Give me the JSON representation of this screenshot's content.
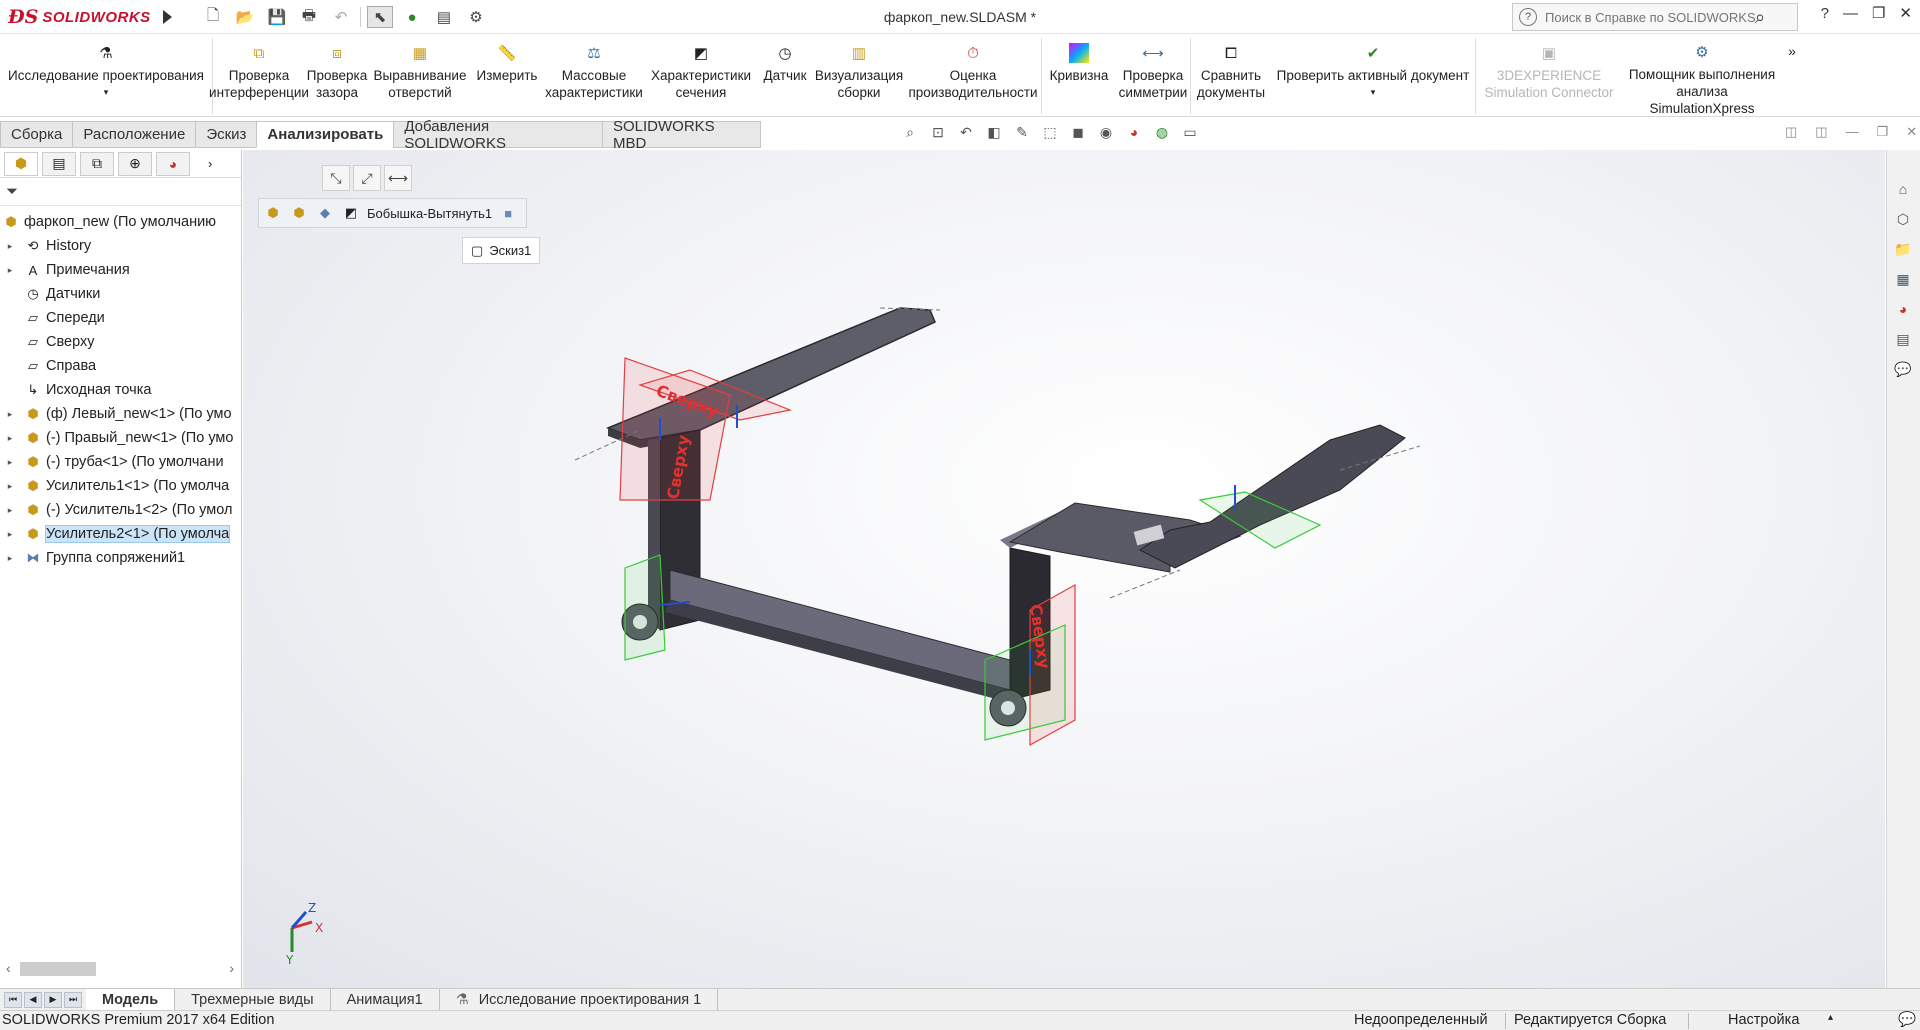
{
  "app": {
    "brand": "SOLIDWORKS",
    "doc_title": "фаркоп_new.SLDASM *"
  },
  "search": {
    "placeholder": "Поиск в Справке по SOLIDWORKS"
  },
  "ribbon": [
    {
      "label": "Исследование проектирования",
      "icon": "design-study-icon"
    },
    {
      "label": "Проверка интерференции",
      "icon": "interference-icon"
    },
    {
      "label": "Проверка зазора",
      "icon": "clearance-icon"
    },
    {
      "label": "Выравнивание отверстий",
      "icon": "hole-align-icon"
    },
    {
      "label": "Измерить",
      "icon": "measure-icon"
    },
    {
      "label": "Массовые характеристики",
      "icon": "mass-props-icon"
    },
    {
      "label": "Характеристики сечения",
      "icon": "section-props-icon"
    },
    {
      "label": "Датчик",
      "icon": "sensor-icon"
    },
    {
      "label": "Визуализация сборки",
      "icon": "assembly-viz-icon"
    },
    {
      "label": "Оценка производительности",
      "icon": "performance-icon"
    },
    {
      "label": "Кривизна",
      "icon": "curvature-icon"
    },
    {
      "label": "Проверка симметрии",
      "icon": "symmetry-icon"
    },
    {
      "label": "Сравнить документы",
      "icon": "compare-icon"
    },
    {
      "label": "Проверить активный документ",
      "icon": "check-doc-icon"
    },
    {
      "label": "3DEXPERIENCE Simulation Connector",
      "icon": "3dx-icon"
    },
    {
      "label": "Помощник выполнения анализа SimulationXpress",
      "icon": "simxpress-icon"
    }
  ],
  "tabs": [
    "Сборка",
    "Расположение",
    "Эскиз",
    "Анализировать",
    "Добавления SOLIDWORKS",
    "SOLIDWORKS MBD"
  ],
  "tree": [
    {
      "label": "фаркоп_new  (По умолчанию",
      "icon": "assembly-icon"
    },
    {
      "label": "History",
      "icon": "history-icon"
    },
    {
      "label": "Примечания",
      "icon": "annotations-icon"
    },
    {
      "label": "Датчики",
      "icon": "sensors-icon"
    },
    {
      "label": "Спереди",
      "icon": "plane-icon"
    },
    {
      "label": "Сверху",
      "icon": "plane-icon"
    },
    {
      "label": "Справа",
      "icon": "plane-icon"
    },
    {
      "label": "Исходная точка",
      "icon": "origin-icon"
    },
    {
      "label": "(ф) Левый_new<1> (По умо",
      "icon": "part-icon"
    },
    {
      "label": "(-) Правый_new<1> (По умо",
      "icon": "part-icon"
    },
    {
      "label": "(-) труба<1> (По умолчани",
      "icon": "part-icon"
    },
    {
      "label": "Усилитель1<1> (По умолча",
      "icon": "part-icon"
    },
    {
      "label": "(-) Усилитель1<2> (По умол",
      "icon": "part-icon"
    },
    {
      "label": "Усилитель2<1> (По умолча",
      "icon": "part-icon"
    },
    {
      "label": "Группа сопряжений1",
      "icon": "mates-icon"
    }
  ],
  "breadcrumb": {
    "feature": "Бобышка-Вытянуть1",
    "sketch": "Эскиз1"
  },
  "viewport": {
    "plane_label": "Сверху"
  },
  "bottom_tabs": [
    "Модель",
    "Трехмерные виды",
    "Анимация1",
    "Исследование проектирования 1"
  ],
  "status": {
    "edition": "SOLIDWORKS Premium 2017 x64 Edition",
    "state": "Недоопределенный",
    "mode": "Редактируется Сборка",
    "settings": "Настройка"
  }
}
